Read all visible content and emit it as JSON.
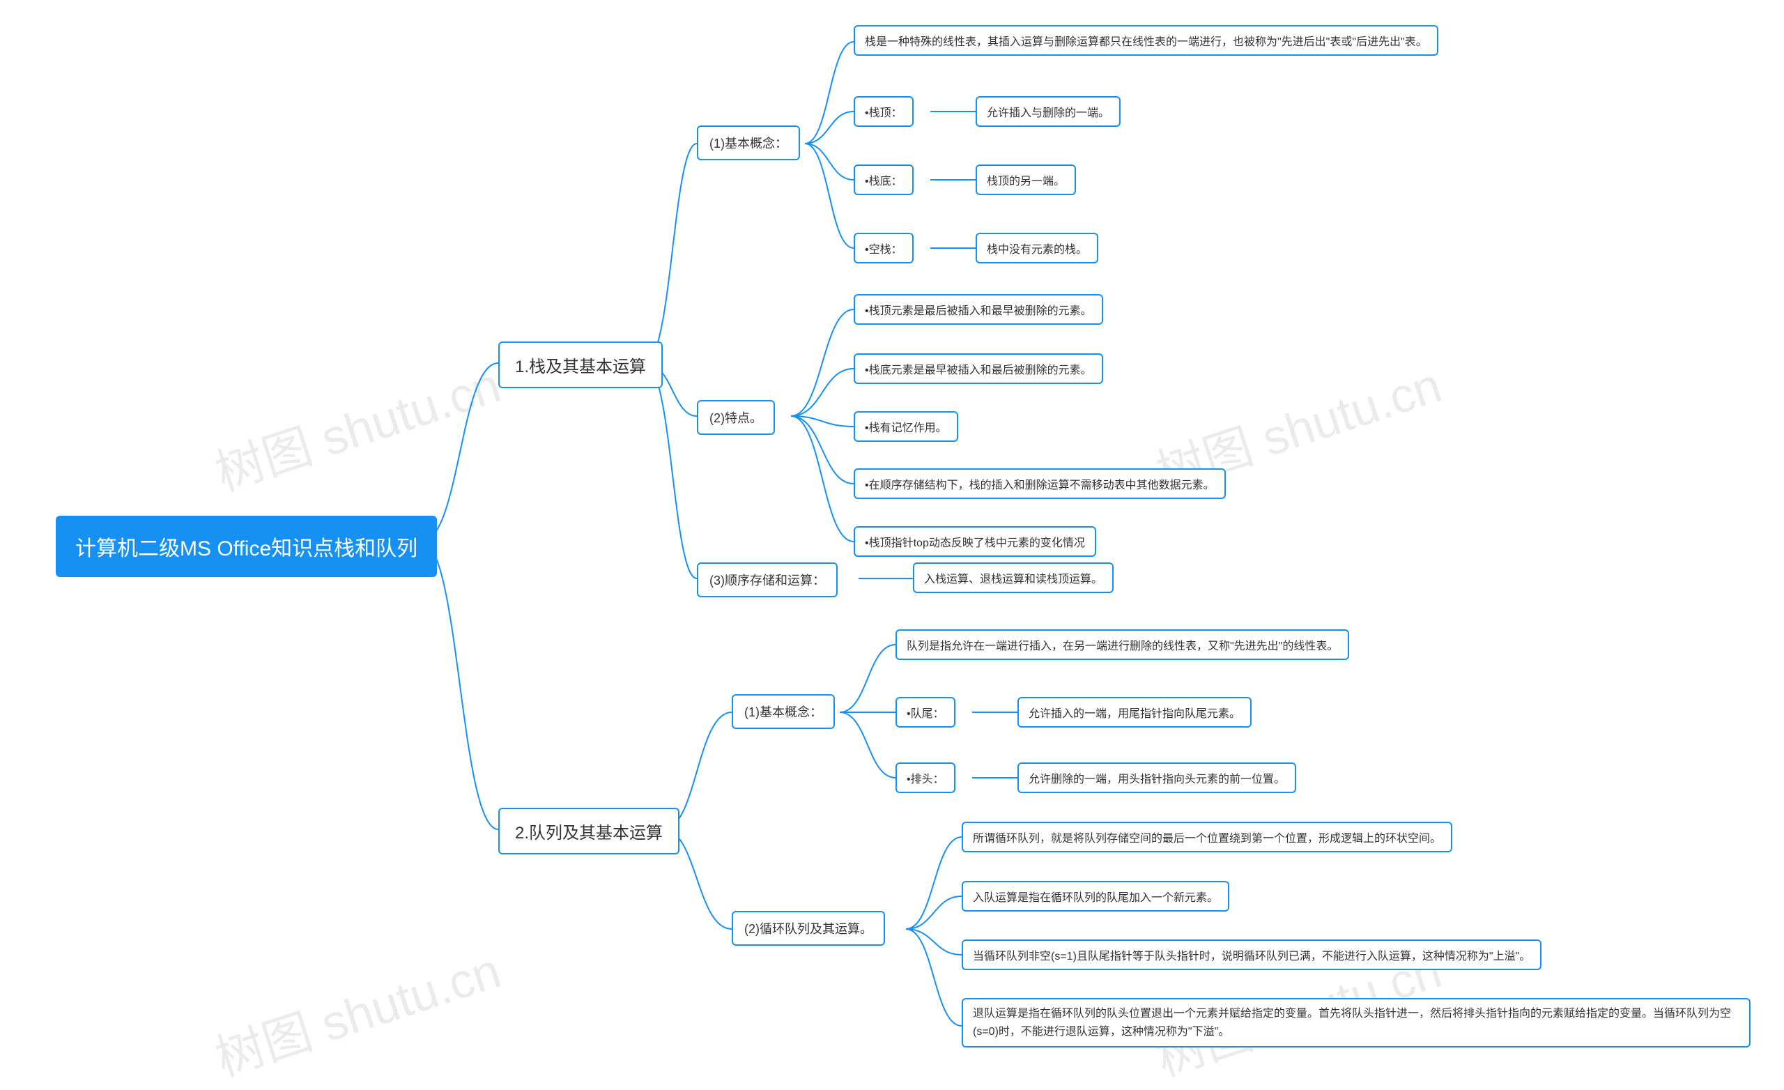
{
  "watermarks": [
    "树图 shutu.cn",
    "树图 shutu.cn",
    "树图 shutu.cn",
    "树图 shutu.cn"
  ],
  "root": {
    "label": "计算机二级MS Office知识点栈和队列"
  },
  "b1": {
    "label": "1.栈及其基本运算"
  },
  "b2": {
    "label": "2.队列及其基本运算"
  },
  "b1_1": {
    "label": "(1)基本概念："
  },
  "b1_2": {
    "label": "(2)特点。"
  },
  "b1_3": {
    "label": "(3)顺序存储和运算："
  },
  "b1_1_a": {
    "label": "栈是一种特殊的线性表，其插入运算与删除运算都只在线性表的一端进行，也被称为\"先进后出\"表或\"后进先出\"表。"
  },
  "b1_1_b": {
    "label": "•栈顶："
  },
  "b1_1_b1": {
    "label": "允许插入与删除的一端。"
  },
  "b1_1_c": {
    "label": "•栈底："
  },
  "b1_1_c1": {
    "label": "栈顶的另一端。"
  },
  "b1_1_d": {
    "label": "•空栈："
  },
  "b1_1_d1": {
    "label": "栈中没有元素的栈。"
  },
  "b1_2_a": {
    "label": "•栈顶元素是最后被插入和最早被删除的元素。"
  },
  "b1_2_b": {
    "label": "•栈底元素是最早被插入和最后被删除的元素。"
  },
  "b1_2_c": {
    "label": "•栈有记忆作用。"
  },
  "b1_2_d": {
    "label": "•在顺序存储结构下，栈的插入和删除运算不需移动表中其他数据元素。"
  },
  "b1_2_e": {
    "label": "•栈顶指针top动态反映了栈中元素的变化情况"
  },
  "b1_3_a": {
    "label": "入栈运算、退栈运算和读栈顶运算。"
  },
  "b2_1": {
    "label": "(1)基本概念："
  },
  "b2_2": {
    "label": "(2)循环队列及其运算。"
  },
  "b2_1_a": {
    "label": "队列是指允许在一端进行插入，在另一端进行删除的线性表，又称\"先进先出\"的线性表。"
  },
  "b2_1_b": {
    "label": "•队尾："
  },
  "b2_1_b1": {
    "label": "允许插入的一端，用尾指针指向队尾元素。"
  },
  "b2_1_c": {
    "label": "•排头："
  },
  "b2_1_c1": {
    "label": "允许删除的一端，用头指针指向头元素的前一位置。"
  },
  "b2_2_a": {
    "label": "所谓循环队列，就是将队列存储空间的最后一个位置绕到第一个位置，形成逻辑上的环状空间。"
  },
  "b2_2_b": {
    "label": "入队运算是指在循环队列的队尾加入一个新元素。"
  },
  "b2_2_c": {
    "label": "当循环队列非空(s=1)且队尾指针等于队头指针时，说明循环队列已满，不能进行入队运算，这种情况称为\"上溢\"。"
  },
  "b2_2_d": {
    "label": "退队运算是指在循环队列的队头位置退出一个元素并赋给指定的变量。首先将队头指针进一，然后将排头指针指向的元素赋给指定的变量。当循环队列为空(s=0)时，不能进行退队运算，这种情况称为\"下溢\"。"
  }
}
